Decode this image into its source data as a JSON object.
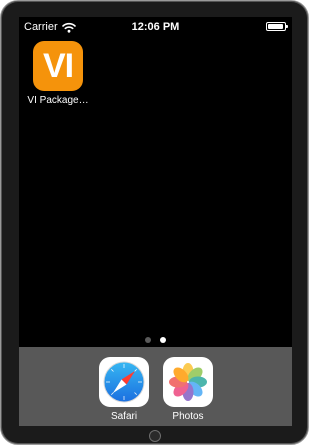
{
  "status_bar": {
    "carrier": "Carrier",
    "wifi_icon": "wifi-icon",
    "time": "12:06 PM",
    "battery_icon": "battery-icon"
  },
  "home_screen": {
    "apps": [
      {
        "icon_text": "VI",
        "label": "VI Package…",
        "icon_color": "#f5930b"
      }
    ],
    "page_indicator": {
      "total_pages": 2,
      "current_page": 2
    }
  },
  "dock": {
    "apps": [
      {
        "label": "Safari",
        "icon": "safari-compass-icon"
      },
      {
        "label": "Photos",
        "icon": "photos-flower-icon"
      }
    ]
  },
  "colors": {
    "screen_background": "#000000",
    "dock_background": "#585858",
    "device_frame": "#1b1b1b"
  }
}
